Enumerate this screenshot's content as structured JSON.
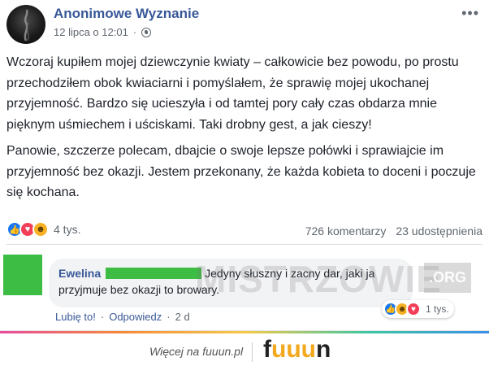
{
  "post": {
    "page_name": "Anonimowe Wyznanie",
    "date": "12 lipca o 12:01",
    "dot": "·",
    "more": "•••",
    "paragraphs": [
      "Wczoraj kupiłem mojej dziewczynie kwiaty – całkowicie bez powodu, po prostu przechodziłem obok kwiaciarni i pomyślałem, że sprawię mojej ukochanej przyjemność. Bardzo się ucieszyła i od tamtej pory cały czas obdarza mnie pięknym uśmiechem i uściskami. Taki drobny gest, a jak cieszy!",
      "Panowie, szczerze polecam, dbajcie o swoje lepsze połówki i sprawiajcie im przyjemność bez okazji. Jestem przekonany, że każda kobieta to doceni i poczuje się kochana."
    ],
    "reaction_count": "4 tys.",
    "comments_count": "726 komentarzy",
    "shares_count": "23 udostępnienia"
  },
  "comment": {
    "author": "Ewelina",
    "text": "Jedyny słuszny i zacny dar, jaki ja przyjmuje bez okazji to browary.",
    "reaction_count": "1 tys.",
    "like_label": "Lubię to!",
    "reply_label": "Odpowiedz",
    "time": "2 d"
  },
  "watermark": {
    "text": "MISTRZOWIE",
    "suffix": ".ORG"
  },
  "footer": {
    "text": "Więcej na fuuun.pl",
    "logo_prefix": "f",
    "logo_u": "uuu",
    "logo_suffix": "n"
  },
  "colors": {
    "link": "#385898",
    "like": "#1877f2",
    "love": "#f33e58",
    "haha": "#f7b125",
    "redaction": "#3dbd43"
  },
  "icons": [
    "globe-icon",
    "more-icon",
    "like-reaction-icon",
    "love-reaction-icon",
    "haha-reaction-icon"
  ]
}
